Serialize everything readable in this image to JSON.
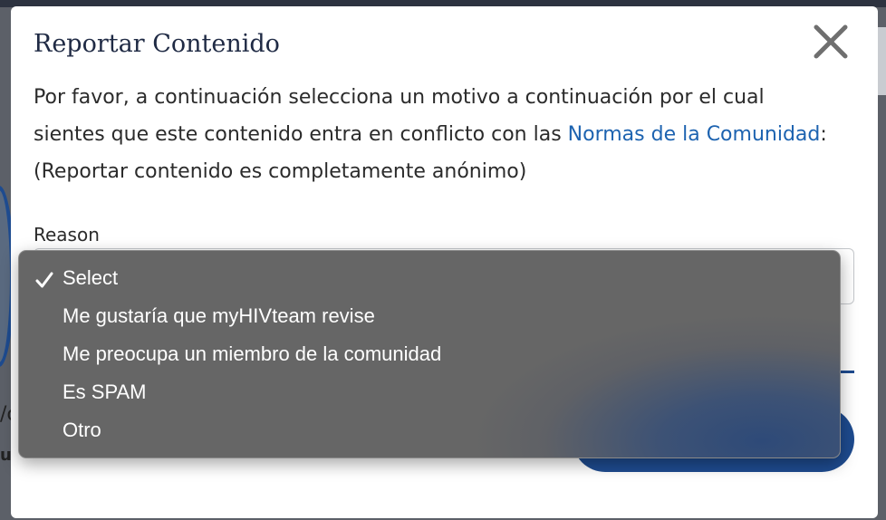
{
  "background": {
    "fragment_left": "/c",
    "fragment_left2": "u"
  },
  "modal": {
    "title": "Reportar Contenido",
    "description_before_link": "Por favor, a continuación selecciona un motivo a continuación por el cual sientes que este contenido entra en conflicto con las ",
    "link_text": "Normas de la Comunidad",
    "description_after_link": ": (Reportar contenido es completamente anónimo)",
    "reason_label": "Reason",
    "close_icon": "close-icon"
  },
  "dropdown": {
    "selected": "Select",
    "options": [
      "Select",
      "Me gustaría que myHIVteam revise",
      "Me preocupa un miembro de la comunidad",
      "Es SPAM",
      "Otro"
    ]
  },
  "colors": {
    "title": "#1f2a44",
    "link": "#1d63b0",
    "accent": "#1e4b8f",
    "dropdown_bg": "#666666"
  }
}
